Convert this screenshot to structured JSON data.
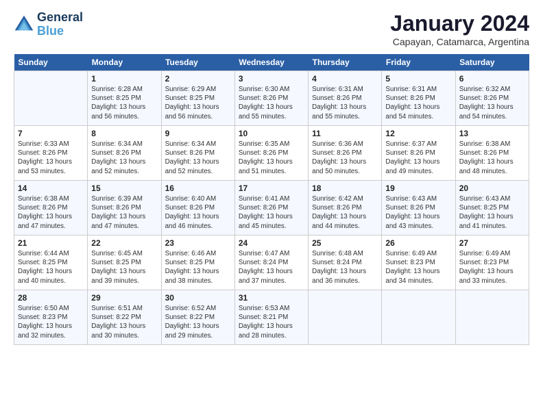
{
  "logo": {
    "line1": "General",
    "line2": "Blue"
  },
  "title": "January 2024",
  "subtitle": "Capayan, Catamarca, Argentina",
  "days_header": [
    "Sunday",
    "Monday",
    "Tuesday",
    "Wednesday",
    "Thursday",
    "Friday",
    "Saturday"
  ],
  "weeks": [
    [
      {
        "day": "",
        "sunrise": "",
        "sunset": "",
        "daylight": ""
      },
      {
        "day": "1",
        "sunrise": "Sunrise: 6:28 AM",
        "sunset": "Sunset: 8:25 PM",
        "daylight": "Daylight: 13 hours and 56 minutes."
      },
      {
        "day": "2",
        "sunrise": "Sunrise: 6:29 AM",
        "sunset": "Sunset: 8:25 PM",
        "daylight": "Daylight: 13 hours and 56 minutes."
      },
      {
        "day": "3",
        "sunrise": "Sunrise: 6:30 AM",
        "sunset": "Sunset: 8:26 PM",
        "daylight": "Daylight: 13 hours and 55 minutes."
      },
      {
        "day": "4",
        "sunrise": "Sunrise: 6:31 AM",
        "sunset": "Sunset: 8:26 PM",
        "daylight": "Daylight: 13 hours and 55 minutes."
      },
      {
        "day": "5",
        "sunrise": "Sunrise: 6:31 AM",
        "sunset": "Sunset: 8:26 PM",
        "daylight": "Daylight: 13 hours and 54 minutes."
      },
      {
        "day": "6",
        "sunrise": "Sunrise: 6:32 AM",
        "sunset": "Sunset: 8:26 PM",
        "daylight": "Daylight: 13 hours and 54 minutes."
      }
    ],
    [
      {
        "day": "7",
        "sunrise": "Sunrise: 6:33 AM",
        "sunset": "Sunset: 8:26 PM",
        "daylight": "Daylight: 13 hours and 53 minutes."
      },
      {
        "day": "8",
        "sunrise": "Sunrise: 6:34 AM",
        "sunset": "Sunset: 8:26 PM",
        "daylight": "Daylight: 13 hours and 52 minutes."
      },
      {
        "day": "9",
        "sunrise": "Sunrise: 6:34 AM",
        "sunset": "Sunset: 8:26 PM",
        "daylight": "Daylight: 13 hours and 52 minutes."
      },
      {
        "day": "10",
        "sunrise": "Sunrise: 6:35 AM",
        "sunset": "Sunset: 8:26 PM",
        "daylight": "Daylight: 13 hours and 51 minutes."
      },
      {
        "day": "11",
        "sunrise": "Sunrise: 6:36 AM",
        "sunset": "Sunset: 8:26 PM",
        "daylight": "Daylight: 13 hours and 50 minutes."
      },
      {
        "day": "12",
        "sunrise": "Sunrise: 6:37 AM",
        "sunset": "Sunset: 8:26 PM",
        "daylight": "Daylight: 13 hours and 49 minutes."
      },
      {
        "day": "13",
        "sunrise": "Sunrise: 6:38 AM",
        "sunset": "Sunset: 8:26 PM",
        "daylight": "Daylight: 13 hours and 48 minutes."
      }
    ],
    [
      {
        "day": "14",
        "sunrise": "Sunrise: 6:38 AM",
        "sunset": "Sunset: 8:26 PM",
        "daylight": "Daylight: 13 hours and 47 minutes."
      },
      {
        "day": "15",
        "sunrise": "Sunrise: 6:39 AM",
        "sunset": "Sunset: 8:26 PM",
        "daylight": "Daylight: 13 hours and 47 minutes."
      },
      {
        "day": "16",
        "sunrise": "Sunrise: 6:40 AM",
        "sunset": "Sunset: 8:26 PM",
        "daylight": "Daylight: 13 hours and 46 minutes."
      },
      {
        "day": "17",
        "sunrise": "Sunrise: 6:41 AM",
        "sunset": "Sunset: 8:26 PM",
        "daylight": "Daylight: 13 hours and 45 minutes."
      },
      {
        "day": "18",
        "sunrise": "Sunrise: 6:42 AM",
        "sunset": "Sunset: 8:26 PM",
        "daylight": "Daylight: 13 hours and 44 minutes."
      },
      {
        "day": "19",
        "sunrise": "Sunrise: 6:43 AM",
        "sunset": "Sunset: 8:26 PM",
        "daylight": "Daylight: 13 hours and 43 minutes."
      },
      {
        "day": "20",
        "sunrise": "Sunrise: 6:43 AM",
        "sunset": "Sunset: 8:25 PM",
        "daylight": "Daylight: 13 hours and 41 minutes."
      }
    ],
    [
      {
        "day": "21",
        "sunrise": "Sunrise: 6:44 AM",
        "sunset": "Sunset: 8:25 PM",
        "daylight": "Daylight: 13 hours and 40 minutes."
      },
      {
        "day": "22",
        "sunrise": "Sunrise: 6:45 AM",
        "sunset": "Sunset: 8:25 PM",
        "daylight": "Daylight: 13 hours and 39 minutes."
      },
      {
        "day": "23",
        "sunrise": "Sunrise: 6:46 AM",
        "sunset": "Sunset: 8:25 PM",
        "daylight": "Daylight: 13 hours and 38 minutes."
      },
      {
        "day": "24",
        "sunrise": "Sunrise: 6:47 AM",
        "sunset": "Sunset: 8:24 PM",
        "daylight": "Daylight: 13 hours and 37 minutes."
      },
      {
        "day": "25",
        "sunrise": "Sunrise: 6:48 AM",
        "sunset": "Sunset: 8:24 PM",
        "daylight": "Daylight: 13 hours and 36 minutes."
      },
      {
        "day": "26",
        "sunrise": "Sunrise: 6:49 AM",
        "sunset": "Sunset: 8:23 PM",
        "daylight": "Daylight: 13 hours and 34 minutes."
      },
      {
        "day": "27",
        "sunrise": "Sunrise: 6:49 AM",
        "sunset": "Sunset: 8:23 PM",
        "daylight": "Daylight: 13 hours and 33 minutes."
      }
    ],
    [
      {
        "day": "28",
        "sunrise": "Sunrise: 6:50 AM",
        "sunset": "Sunset: 8:23 PM",
        "daylight": "Daylight: 13 hours and 32 minutes."
      },
      {
        "day": "29",
        "sunrise": "Sunrise: 6:51 AM",
        "sunset": "Sunset: 8:22 PM",
        "daylight": "Daylight: 13 hours and 30 minutes."
      },
      {
        "day": "30",
        "sunrise": "Sunrise: 6:52 AM",
        "sunset": "Sunset: 8:22 PM",
        "daylight": "Daylight: 13 hours and 29 minutes."
      },
      {
        "day": "31",
        "sunrise": "Sunrise: 6:53 AM",
        "sunset": "Sunset: 8:21 PM",
        "daylight": "Daylight: 13 hours and 28 minutes."
      },
      {
        "day": "",
        "sunrise": "",
        "sunset": "",
        "daylight": ""
      },
      {
        "day": "",
        "sunrise": "",
        "sunset": "",
        "daylight": ""
      },
      {
        "day": "",
        "sunrise": "",
        "sunset": "",
        "daylight": ""
      }
    ]
  ]
}
